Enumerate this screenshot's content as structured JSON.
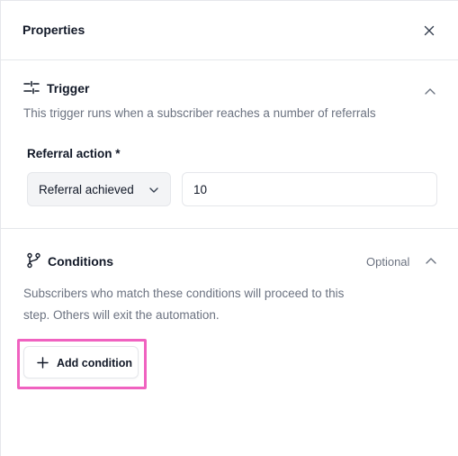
{
  "panel": {
    "title": "Properties",
    "close_icon": "close-icon"
  },
  "trigger": {
    "icon": "sliders-icon",
    "title": "Trigger",
    "description": "This trigger runs when a subscriber reaches a number of referrals",
    "field_label": "Referral action *",
    "select_value": "Referral achieved",
    "input_value": "10"
  },
  "conditions": {
    "icon": "git-branch-icon",
    "title": "Conditions",
    "optional_label": "Optional",
    "description": "Subscribers who match these conditions will proceed to this step. Others will exit the automation.",
    "add_button_label": "Add condition"
  },
  "colors": {
    "highlight": "#f062c0",
    "border": "#e5e7eb",
    "muted_text": "#6b7280"
  }
}
